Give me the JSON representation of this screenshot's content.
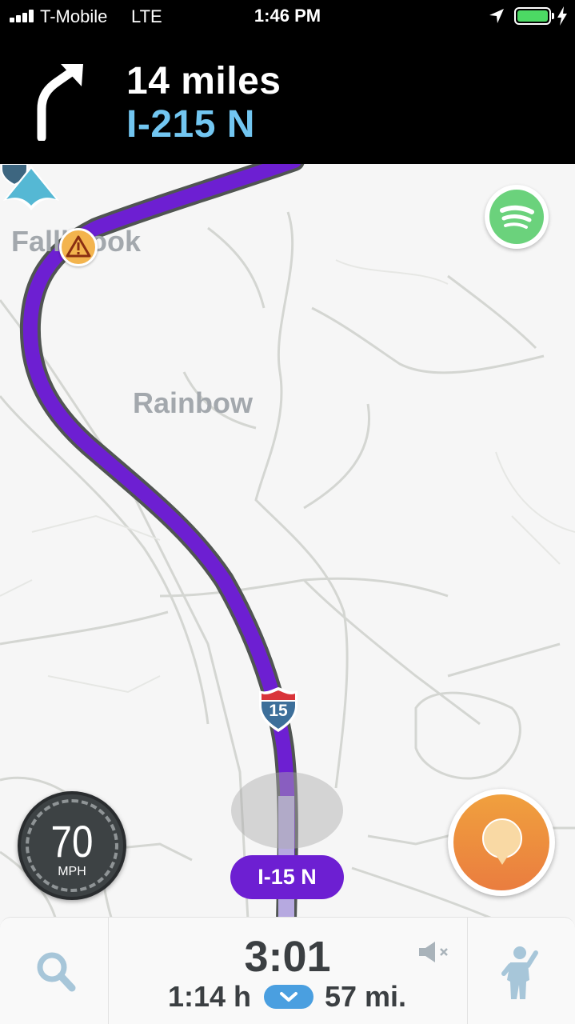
{
  "status_bar": {
    "carrier": "T-Mobile",
    "network": "LTE",
    "time": "1:46 PM",
    "battery_color": "#4cd964",
    "icons": [
      "signal-icon",
      "location-arrow-icon",
      "battery-icon",
      "charging-bolt-icon"
    ]
  },
  "navigation": {
    "distance": "14 miles",
    "road": "I-215 N",
    "turn_icon": "turn-right-icon",
    "road_color": "#72c6f1"
  },
  "map": {
    "labels": {
      "fallbrook": "Fallbrook",
      "rainbow": "Rainbow"
    },
    "shield_number": "15",
    "route_color": "#6d1fd2",
    "icons": [
      "hazard-icon",
      "interstate-shield-icon",
      "car-arrow-icon",
      "spotify-icon"
    ]
  },
  "speedometer": {
    "speed": "70",
    "unit": "MPH"
  },
  "current_road": "I-15 N",
  "bottom_bar": {
    "eta": "3:01",
    "duration": "1:14 h",
    "distance": "57 mi.",
    "icons": [
      "search-icon",
      "chevron-down-icon",
      "sound-muted-icon",
      "report-person-icon"
    ]
  }
}
